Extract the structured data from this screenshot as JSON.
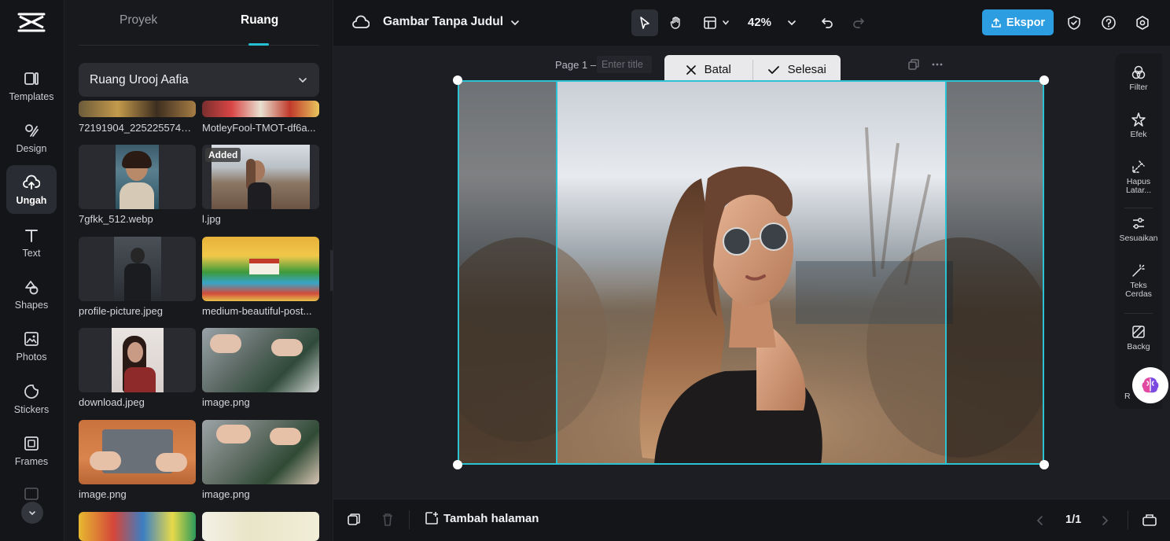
{
  "rail": {
    "items": [
      {
        "label": "Templates",
        "icon": "templates-icon"
      },
      {
        "label": "Design",
        "icon": "design-icon"
      },
      {
        "label": "Ungah",
        "icon": "upload-cloud-icon"
      },
      {
        "label": "Text",
        "icon": "text-icon"
      },
      {
        "label": "Shapes",
        "icon": "shapes-icon"
      },
      {
        "label": "Photos",
        "icon": "photos-icon"
      },
      {
        "label": "Stickers",
        "icon": "stickers-icon"
      },
      {
        "label": "Frames",
        "icon": "frames-icon"
      }
    ],
    "active_index": 2
  },
  "panel": {
    "tabs": [
      {
        "label": "Proyek"
      },
      {
        "label": "Ruang"
      }
    ],
    "space_name": "Ruang Urooj Aafia",
    "thumbs": [
      {
        "label": "72191904_22522557415..."
      },
      {
        "label": "MotleyFool-TMOT-df6a..."
      },
      {
        "label": "7gfkk_512.webp"
      },
      {
        "label": "l.jpg",
        "badge": "Added"
      },
      {
        "label": "profile-picture.jpeg"
      },
      {
        "label": "medium-beautiful-post..."
      },
      {
        "label": "download.jpeg"
      },
      {
        "label": "image.png"
      },
      {
        "label": "image.png"
      },
      {
        "label": "image.png"
      }
    ]
  },
  "topbar": {
    "doc_title": "Gambar Tanpa Judul",
    "zoom": "42%",
    "export_label": "Ekspor"
  },
  "canvas": {
    "page_label": "Page 1 –",
    "title_placeholder": "Enter title",
    "cancel_label": "Batal",
    "done_label": "Selesai"
  },
  "right_panel": {
    "items": [
      {
        "label": "Filter",
        "icon": "filter-icon"
      },
      {
        "label": "Efek",
        "icon": "effects-icon"
      },
      {
        "label": "Hapus Latar...",
        "icon": "remove-background-icon"
      },
      {
        "label": "Sesuaikan",
        "icon": "adjust-icon"
      },
      {
        "label": "Teks Cerdas",
        "icon": "smart-text-icon"
      },
      {
        "label": "Backg",
        "icon": "background-icon"
      }
    ],
    "partial_label": "R"
  },
  "bottombar": {
    "add_page_label": "Tambah halaman",
    "page_count": "1/1"
  },
  "colors": {
    "accent": "#2bc3d4",
    "export": "#2b9de0",
    "background": "#141519"
  }
}
